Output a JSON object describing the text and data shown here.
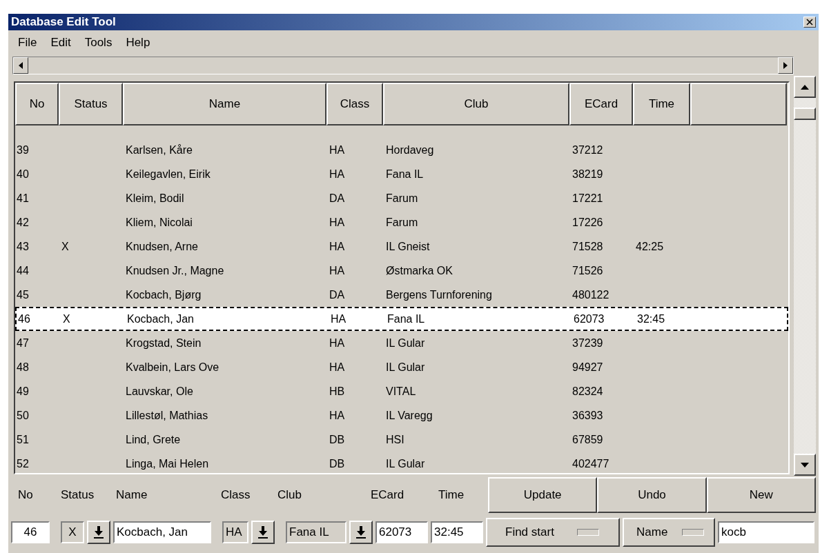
{
  "window": {
    "title": "Database Edit Tool"
  },
  "menu": [
    "File",
    "Edit",
    "Tools",
    "Help"
  ],
  "table": {
    "columns": [
      "No",
      "Status",
      "Name",
      "Class",
      "Club",
      "ECard",
      "Time"
    ],
    "rows": [
      {
        "no": "39",
        "status": "",
        "name": "Karlsen, Kåre",
        "class": "HA",
        "club": "Hordaveg",
        "ecard": "37212",
        "time": "",
        "selected": false
      },
      {
        "no": "40",
        "status": "",
        "name": "Keilegavlen, Eirik",
        "class": "HA",
        "club": "Fana IL",
        "ecard": "38219",
        "time": "",
        "selected": false
      },
      {
        "no": "41",
        "status": "",
        "name": "Kleim, Bodil",
        "class": "DA",
        "club": "Farum",
        "ecard": "17221",
        "time": "",
        "selected": false
      },
      {
        "no": "42",
        "status": "",
        "name": "Kliem, Nicolai",
        "class": "HA",
        "club": "Farum",
        "ecard": "17226",
        "time": "",
        "selected": false
      },
      {
        "no": "43",
        "status": "X",
        "name": "Knudsen, Arne",
        "class": "HA",
        "club": "IL Gneist",
        "ecard": "71528",
        "time": "42:25",
        "selected": false
      },
      {
        "no": "44",
        "status": "",
        "name": "Knudsen Jr., Magne",
        "class": "HA",
        "club": "Østmarka OK",
        "ecard": "71526",
        "time": "",
        "selected": false
      },
      {
        "no": "45",
        "status": "",
        "name": "Kocbach, Bjørg",
        "class": "DA",
        "club": "Bergens Turnforening",
        "ecard": "480122",
        "time": "",
        "selected": false
      },
      {
        "no": "46",
        "status": "X",
        "name": "Kocbach, Jan",
        "class": "HA",
        "club": "Fana IL",
        "ecard": "62073",
        "time": "32:45",
        "selected": true
      },
      {
        "no": "47",
        "status": "",
        "name": "Krogstad, Stein",
        "class": "HA",
        "club": "IL Gular",
        "ecard": "37239",
        "time": "",
        "selected": false
      },
      {
        "no": "48",
        "status": "",
        "name": "Kvalbein, Lars Ove",
        "class": "HA",
        "club": "IL Gular",
        "ecard": "94927",
        "time": "",
        "selected": false
      },
      {
        "no": "49",
        "status": "",
        "name": "Lauvskar, Ole",
        "class": "HB",
        "club": "VITAL",
        "ecard": "82324",
        "time": "",
        "selected": false
      },
      {
        "no": "50",
        "status": "",
        "name": "Lillestøl, Mathias",
        "class": "HA",
        "club": "IL Varegg",
        "ecard": "36393",
        "time": "",
        "selected": false
      },
      {
        "no": "51",
        "status": "",
        "name": "Lind, Grete",
        "class": "DB",
        "club": "HSI",
        "ecard": "67859",
        "time": "",
        "selected": false
      },
      {
        "no": "52",
        "status": "",
        "name": "Linga, Mai Helen",
        "class": "DB",
        "club": "IL Gular",
        "ecard": "402477",
        "time": "",
        "selected": false
      }
    ]
  },
  "editor": {
    "labels": [
      "No",
      "Status",
      "Name",
      "Class",
      "Club",
      "ECard",
      "Time"
    ],
    "no": "46",
    "status": "X",
    "name": "Kocbach, Jan",
    "class": "HA",
    "club": "Fana IL",
    "ecard": "62073",
    "time": "32:45"
  },
  "buttons": [
    "Update",
    "Undo",
    "New"
  ],
  "find_button": "Find start",
  "sort_button": "Name",
  "search": {
    "value": "kocb"
  }
}
